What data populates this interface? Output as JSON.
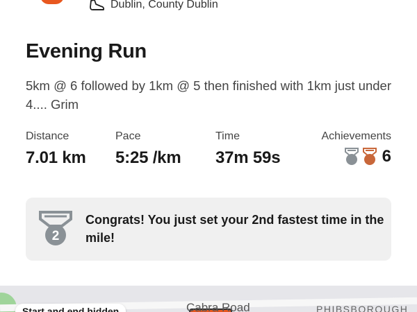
{
  "header": {
    "location": "Dublin, County Dublin",
    "activity_icon": "running-shoe-icon"
  },
  "activity": {
    "title": "Evening Run",
    "description": "5km @ 6 followed by 1km @ 5 then finished with 1km just under 4.... Grim"
  },
  "stats": {
    "distance": {
      "label": "Distance",
      "value": "7.01 km"
    },
    "pace": {
      "label": "Pace",
      "value": "5:25 /km"
    },
    "time": {
      "label": "Time",
      "value": "37m 59s"
    },
    "achievements": {
      "label": "Achievements",
      "count": "6",
      "icons": [
        "silver-medal-icon",
        "bronze-medal-icon"
      ]
    }
  },
  "congrats": {
    "rank": "2",
    "message": "Congrats! You just set your 2nd fastest time in the mile!"
  },
  "map": {
    "privacy_label": "Start and end hidden",
    "road_label": "Cabra Road",
    "area_label": "PHIBSBOROUGH"
  },
  "colors": {
    "accent": "#e8581f",
    "silver": "#8a9196",
    "card_bg": "#f0f0f0"
  }
}
